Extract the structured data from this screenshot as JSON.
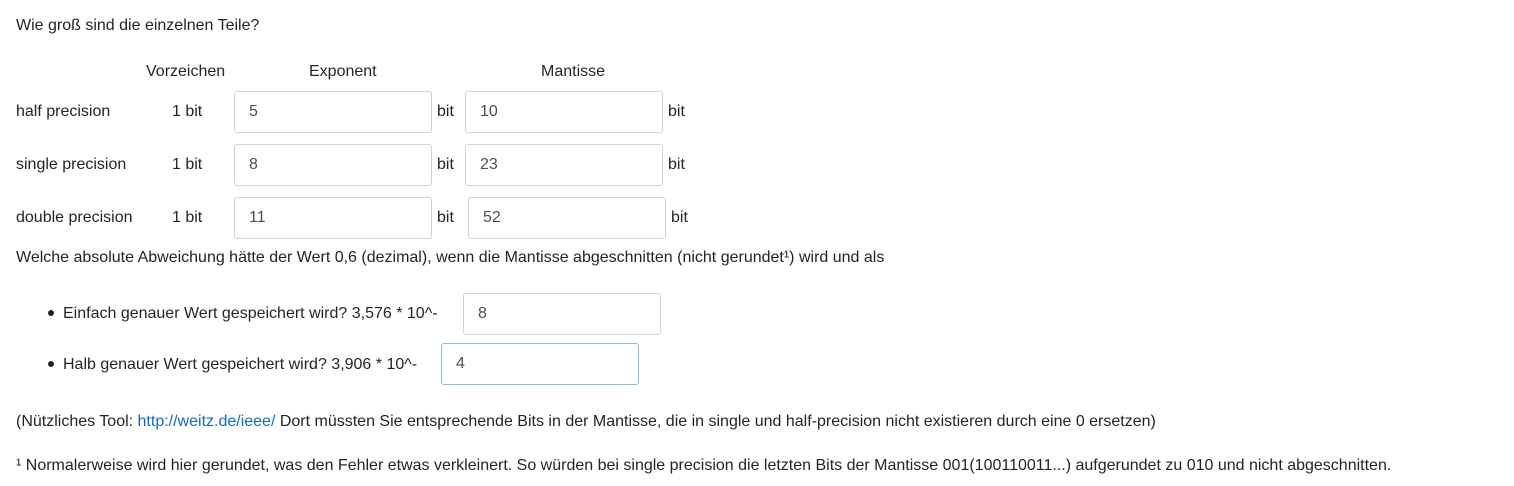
{
  "question": "Wie groß sind die einzelnen Teile?",
  "headers": {
    "vorzeichen": "Vorzeichen",
    "exponent": "Exponent",
    "mantisse": "Mantisse"
  },
  "unit": "bit",
  "rows": [
    {
      "label": "half precision",
      "sign": "1 bit",
      "exponent": "5",
      "mantisse": "10"
    },
    {
      "label": "single precision",
      "sign": "1 bit",
      "exponent": "8",
      "mantisse": "23"
    },
    {
      "label": "double precision",
      "sign": "1 bit",
      "exponent": "11",
      "mantisse": "52"
    }
  ],
  "deviation_question": "Welche absolute Abweichung hätte der Wert 0,6 (dezimal), wenn die Mantisse abgeschnitten (nicht gerundet¹) wird und als",
  "bullets": [
    {
      "text": "Einfach genauer Wert gespeichert wird? 3,576 * 10^-",
      "value": "8"
    },
    {
      "text": "Halb genauer Wert gespeichert wird? 3,906 * 10^-",
      "value": "4"
    }
  ],
  "tool_note": {
    "prefix": "(Nützliches Tool: ",
    "link": "http://weitz.de/ieee/",
    "suffix": " Dort müssten Sie entsprechende Bits in der Mantisse, die in single und half-precision nicht existieren durch eine 0 ersetzen)"
  },
  "footnote": "¹ Normalerweise wird hier gerundet, was den Fehler etwas verkleinert. So würden bei single precision die letzten Bits der Mantisse 001(100110011...) aufgerundet zu 010 und nicht abgeschnitten."
}
